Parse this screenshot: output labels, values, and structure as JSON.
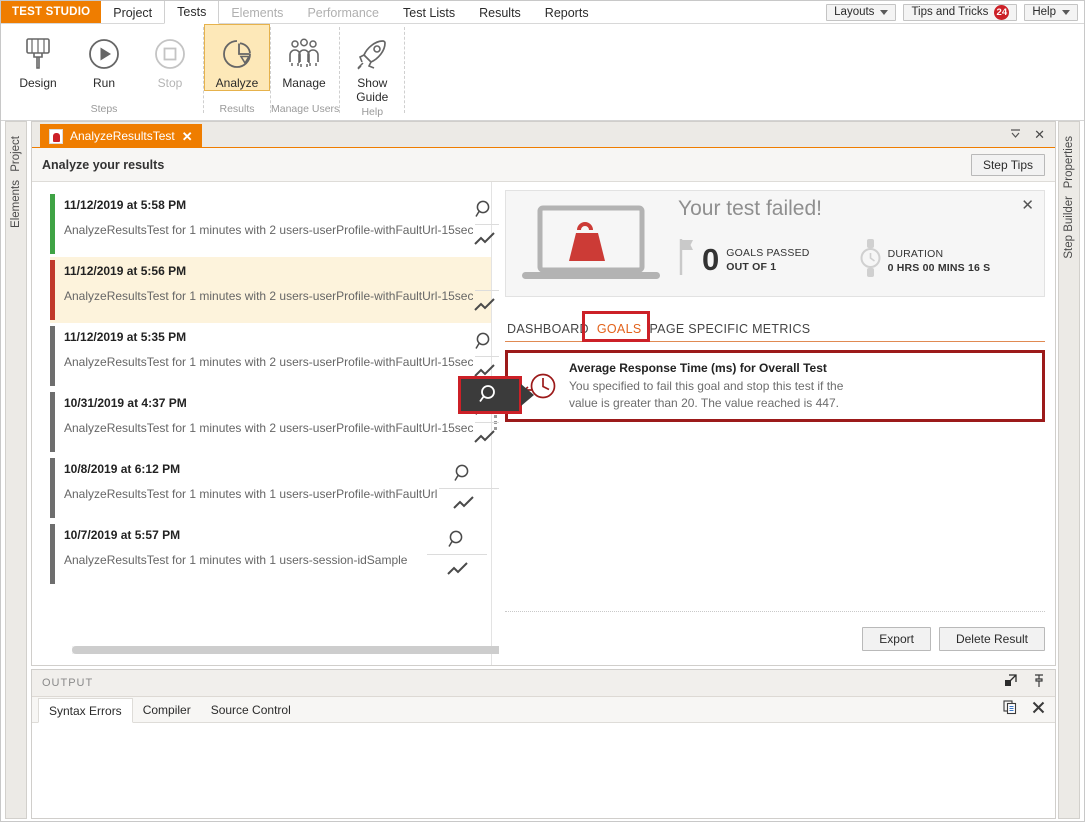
{
  "menubar": {
    "brand": "TEST STUDIO",
    "items": [
      {
        "label": "Project",
        "state": "normal"
      },
      {
        "label": "Tests",
        "state": "active"
      },
      {
        "label": "Elements",
        "state": "disabled"
      },
      {
        "label": "Performance",
        "state": "disabled"
      },
      {
        "label": "Test Lists",
        "state": "normal"
      },
      {
        "label": "Results",
        "state": "normal"
      },
      {
        "label": "Reports",
        "state": "normal"
      }
    ],
    "layouts_label": "Layouts",
    "tips_label": "Tips and Tricks",
    "tips_count": "24",
    "help_label": "Help",
    "brand_color": "#ef7d00",
    "badge_color": "#cc2027"
  },
  "ribbon": {
    "groups": [
      {
        "group_label": "Steps",
        "buttons": [
          {
            "label": "Design",
            "icon": "brush-icon",
            "state": "normal"
          },
          {
            "label": "Run",
            "icon": "play-circle-icon",
            "state": "normal"
          },
          {
            "label": "Stop",
            "icon": "stop-circle-icon",
            "state": "disabled"
          }
        ]
      },
      {
        "group_label": "Results",
        "buttons": [
          {
            "label": "Analyze",
            "icon": "pie-chart-icon",
            "state": "selected"
          }
        ]
      },
      {
        "group_label": "Manage Users",
        "buttons": [
          {
            "label": "Manage",
            "icon": "users-icon",
            "state": "normal"
          }
        ]
      },
      {
        "group_label": "Help",
        "buttons": [
          {
            "label": "Show Guide",
            "icon": "rocket-icon",
            "state": "normal"
          }
        ]
      }
    ]
  },
  "left_rail": {
    "items": [
      "Project",
      "Elements"
    ]
  },
  "right_rail": {
    "items": [
      "Properties",
      "Step Builder"
    ]
  },
  "document": {
    "tab_label": "AnalyzeResultsTest",
    "tab_close": "✕",
    "pin_icon": "⌄",
    "close_icon": "✕",
    "header_title": "Analyze your results",
    "step_tips_label": "Step Tips"
  },
  "results_list": {
    "items": [
      {
        "date": "11/12/2019 at 5:58 PM",
        "description": "AnalyzeResultsTest for 1 minutes with 2 users-userProfile-withFaultUrl-15sec",
        "status_color": "#3fa345",
        "selected": false
      },
      {
        "date": "11/12/2019 at 5:56 PM",
        "description": "AnalyzeResultsTest for 1 minutes with 2 users-userProfile-withFaultUrl-15sec",
        "status_color": "#c0392b",
        "selected": true
      },
      {
        "date": "11/12/2019 at 5:35 PM",
        "description": "AnalyzeResultsTest for 1 minutes with 2 users-userProfile-withFaultUrl-15sec",
        "status_color": "#6e6e6e",
        "selected": false
      },
      {
        "date": "10/31/2019 at 4:37 PM",
        "description": "AnalyzeResultsTest for 1 minutes with 2 users-userProfile-withFaultUrl-15sec",
        "status_color": "#6e6e6e",
        "selected": false
      },
      {
        "date": "10/8/2019 at 6:12 PM",
        "description": "AnalyzeResultsTest for 1 minutes with 1 users-userProfile-withFaultUrl",
        "status_color": "#6e6e6e",
        "selected": false
      },
      {
        "date": "10/7/2019 at 5:57 PM",
        "description": "AnalyzeResultsTest for 1 minutes with 1 users-session-idSample",
        "status_color": "#6e6e6e",
        "selected": false
      }
    ],
    "row_icons": [
      "magnifier-icon",
      "trend-line-icon"
    ]
  },
  "summary": {
    "title": "Your test failed!",
    "icon": "laptop-with-weight-icon",
    "close_icon": "✕",
    "goals": {
      "value": "0",
      "line1": "GOALS PASSED",
      "line2": "OUT OF 1",
      "icon": "flag-icon"
    },
    "duration": {
      "line1": "DURATION",
      "line2": "0 HRS  00 MINS  16 S",
      "icon": "watch-icon"
    }
  },
  "detail_tabs": [
    {
      "label": "DASHBOARD",
      "active": false
    },
    {
      "label": "GOALS",
      "active": true
    },
    {
      "label": "PAGE SPECIFIC METRICS",
      "active": false
    }
  ],
  "goal_card": {
    "icon": "response-time-clock-icon",
    "title": "Average Response Time (ms) for Overall Test",
    "desc_line1": "You specified to fail this goal and stop this test if the",
    "desc_line2": "value is greater than 20. The value reached is 447.",
    "border_color": "#9c1a1a"
  },
  "detail_footer": {
    "export_label": "Export",
    "delete_label": "Delete Result"
  },
  "output": {
    "title": "OUTPUT",
    "header_icons": [
      "undock-icon",
      "pin-icon"
    ],
    "tabs": [
      {
        "label": "Syntax Errors",
        "active": true
      },
      {
        "label": "Compiler",
        "active": false
      },
      {
        "label": "Source Control",
        "active": false
      }
    ],
    "tab_icons": [
      "copy-icon",
      "close-icon"
    ],
    "content": ""
  },
  "accent": {
    "orange": "#ef7d00",
    "red": "#cc2027",
    "highlight": "#fdf3dc"
  }
}
